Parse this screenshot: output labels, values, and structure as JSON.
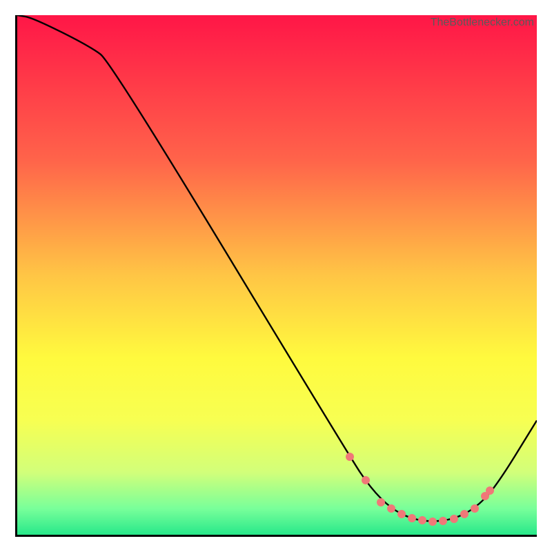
{
  "watermark": "TheBottlenecker.com",
  "chart_data": {
    "type": "line",
    "title": "",
    "xlabel": "",
    "ylabel": "",
    "xlim": [
      0,
      100
    ],
    "ylim": [
      0,
      100
    ],
    "series": [
      {
        "name": "curve",
        "x": [
          0,
          3,
          14,
          18,
          64,
          68,
          72,
          76,
          80,
          84,
          88,
          92,
          100
        ],
        "y": [
          100,
          99.5,
          94,
          91,
          15,
          9,
          5,
          3,
          2.5,
          3,
          5,
          9,
          22
        ]
      }
    ],
    "highlighted_points": {
      "name": "markers",
      "x": [
        64,
        67,
        70,
        72,
        74,
        76,
        78,
        80,
        82,
        84,
        86,
        88,
        90,
        91
      ],
      "y": [
        15,
        10.5,
        6.2,
        5,
        4,
        3.2,
        2.8,
        2.5,
        2.6,
        3,
        4,
        5,
        7.5,
        8.5
      ]
    },
    "gradient_stops": [
      {
        "offset": 0,
        "color": "#ff1647"
      },
      {
        "offset": 28,
        "color": "#ff644a"
      },
      {
        "offset": 50,
        "color": "#ffc545"
      },
      {
        "offset": 66,
        "color": "#fffa3e"
      },
      {
        "offset": 78,
        "color": "#f7ff52"
      },
      {
        "offset": 88,
        "color": "#d2ff7a"
      },
      {
        "offset": 95,
        "color": "#78ff9a"
      },
      {
        "offset": 100,
        "color": "#28e88a"
      }
    ]
  }
}
